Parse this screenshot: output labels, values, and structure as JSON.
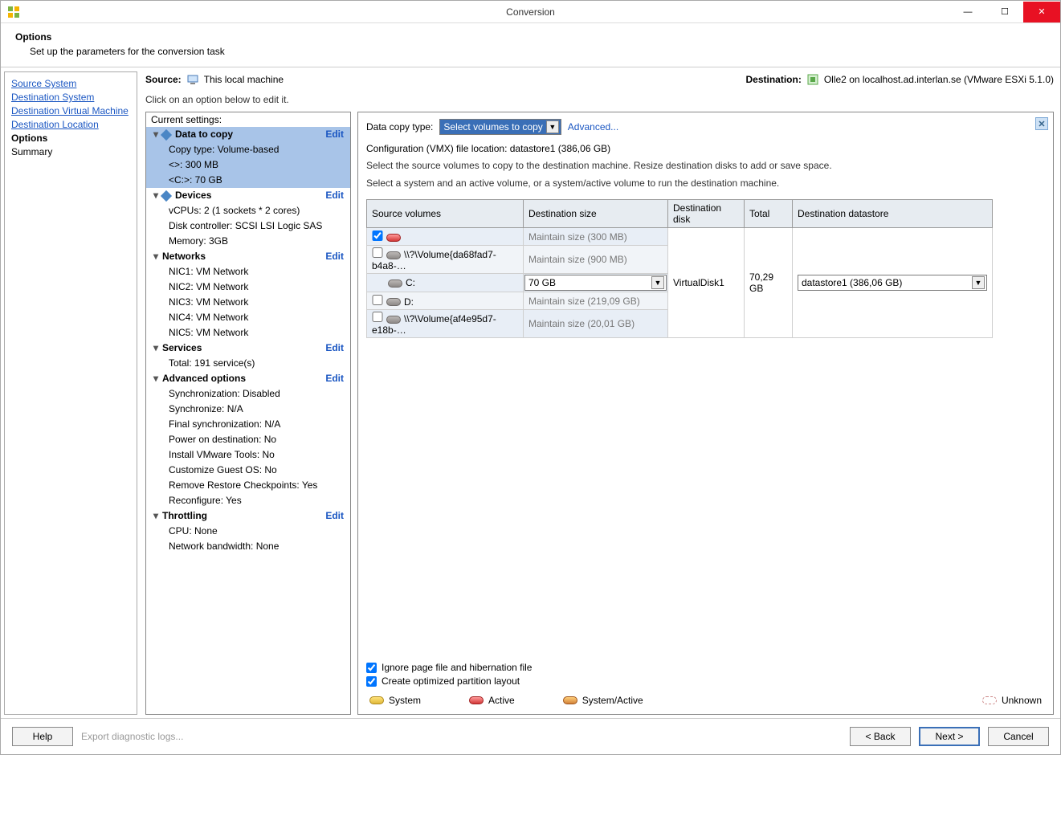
{
  "titlebar": {
    "title": "Conversion"
  },
  "header": {
    "title": "Options",
    "sub": "Set up the parameters for the conversion task"
  },
  "nav": {
    "links": [
      "Source System",
      "Destination System",
      "Destination Virtual Machine",
      "Destination Location"
    ],
    "current": "Options",
    "after": "Summary"
  },
  "sourceLabel": "Source:",
  "sourceText": "This local machine",
  "destLabel": "Destination:",
  "destText": "Olle2 on localhost.ad.interlan.se (VMware ESXi 5.1.0)",
  "instr": "Click on an option below to edit it.",
  "currentSettingsLabel": "Current settings:",
  "editLabel": "Edit",
  "sections": {
    "data": {
      "title": "Data to copy",
      "rows": [
        "Copy type: Volume-based",
        "<>: 300 MB",
        "<C:>: 70 GB"
      ]
    },
    "devices": {
      "title": "Devices",
      "rows": [
        "vCPUs: 2 (1 sockets * 2 cores)",
        "Disk controller: SCSI LSI Logic SAS",
        "Memory: 3GB"
      ]
    },
    "networks": {
      "title": "Networks",
      "rows": [
        "NIC1: VM Network",
        "NIC2: VM Network",
        "NIC3: VM Network",
        "NIC4: VM Network",
        "NIC5: VM Network"
      ]
    },
    "services": {
      "title": "Services",
      "rows": [
        "Total: 191 service(s)"
      ]
    },
    "advanced": {
      "title": "Advanced options",
      "rows": [
        "Synchronization: Disabled",
        "Synchronize: N/A",
        "Final synchronization: N/A",
        "Power on destination: No",
        "Install VMware Tools: No",
        "Customize Guest OS: No",
        "Remove Restore Checkpoints: Yes",
        "Reconfigure: Yes"
      ]
    },
    "throttling": {
      "title": "Throttling",
      "rows": [
        "CPU: None",
        "Network bandwidth: None"
      ]
    }
  },
  "right": {
    "dataCopyTypeLabel": "Data copy type:",
    "dataCopyTypeValue": "Select volumes to copy",
    "advancedLink": "Advanced...",
    "cfgLine": "Configuration (VMX) file location: datastore1 (386,06 GB)",
    "help1": "Select the source volumes to copy to the destination machine. Resize destination disks to add or save space.",
    "help2": "Select a system and an active volume, or a system/active volume to run the destination machine.",
    "cols": {
      "c1": "Source volumes",
      "c2": "Destination size",
      "c3": "Destination disk",
      "c4": "Total",
      "c5": "Destination datastore"
    },
    "rows": [
      {
        "checked": true,
        "iconColor": "r",
        "name": "",
        "dest": "Maintain size (300 MB)",
        "destGrey": true
      },
      {
        "checked": false,
        "iconColor": "g",
        "name": "\\\\?\\Volume{da68fad7-b4a8-…",
        "dest": "Maintain size (900 MB)",
        "destGrey": true
      },
      {
        "checked": null,
        "iconColor": "g",
        "name": "C:",
        "dest": "70 GB",
        "destInput": true
      },
      {
        "checked": false,
        "iconColor": "g",
        "name": "D:",
        "dest": "Maintain size (219,09 GB)",
        "destGrey": true
      },
      {
        "checked": false,
        "iconColor": "g",
        "name": "\\\\?\\Volume{af4e95d7-e18b-…",
        "dest": "Maintain size (20,01 GB)",
        "destGrey": true
      }
    ],
    "diskLabel": "VirtualDisk1",
    "totalLabel": "70,29 GB",
    "datastoreValue": "datastore1 (386,06 GB)",
    "ignoreLabel": "Ignore page file and hibernation file",
    "optimizedLabel": "Create optimized partition layout",
    "legend": {
      "system": "System",
      "active": "Active",
      "sysactive": "System/Active",
      "unknown": "Unknown"
    }
  },
  "footer": {
    "help": "Help",
    "diag": "Export diagnostic logs...",
    "back": "< Back",
    "next": "Next >",
    "cancel": "Cancel"
  }
}
